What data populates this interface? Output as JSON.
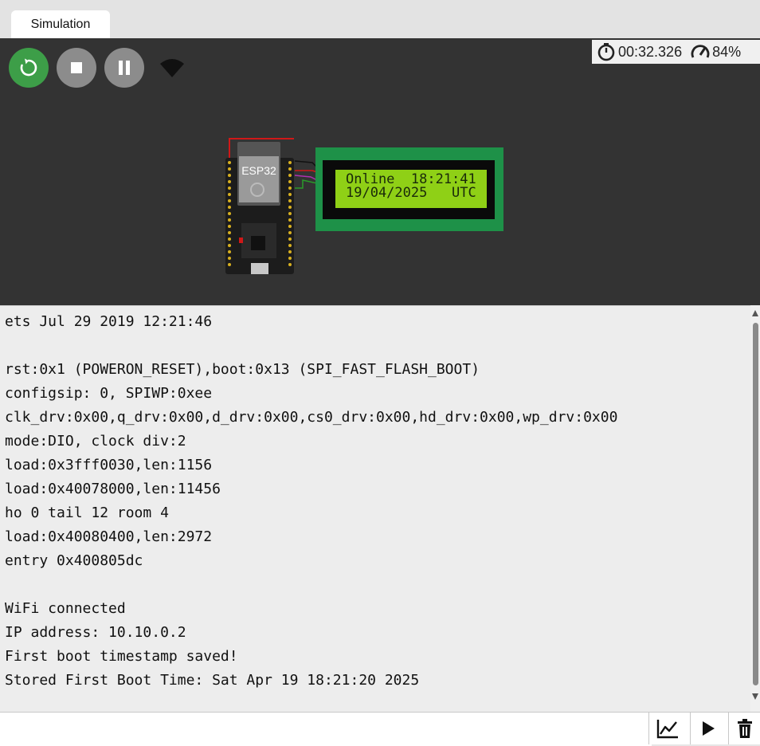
{
  "tabs": [
    {
      "label": "Simulation"
    }
  ],
  "controls": {
    "restart": "restart-icon",
    "stop": "stop-icon",
    "pause": "pause-icon",
    "wifi": "wifi-icon",
    "accent_color": "#3d9e48"
  },
  "status": {
    "timer": "00:32.326",
    "speed": "84%"
  },
  "board": {
    "label": "ESP32"
  },
  "lcd": {
    "line1": "Online  18:21:41",
    "line2": "19/04/2025   UTC",
    "backlight_color": "#8fd016"
  },
  "console": {
    "lines": [
      "ets Jul 29 2019 12:21:46",
      "",
      "rst:0x1 (POWERON_RESET),boot:0x13 (SPI_FAST_FLASH_BOOT)",
      "configsip: 0, SPIWP:0xee",
      "clk_drv:0x00,q_drv:0x00,d_drv:0x00,cs0_drv:0x00,hd_drv:0x00,wp_drv:0x00",
      "mode:DIO, clock div:2",
      "load:0x3fff0030,len:1156",
      "load:0x40078000,len:11456",
      "ho 0 tail 12 room 4",
      "load:0x40080400,len:2972",
      "entry 0x400805dc",
      "",
      "WiFi connected",
      "IP address: 10.10.0.2",
      "First boot timestamp saved!",
      "Stored First Boot Time: Sat Apr 19 18:21:20 2025"
    ]
  },
  "input": {
    "value": "",
    "placeholder": ""
  },
  "toolbar": {
    "plotter": "chart-icon",
    "send": "play-icon",
    "clear": "trash-icon"
  }
}
